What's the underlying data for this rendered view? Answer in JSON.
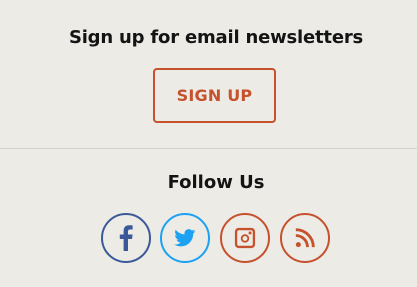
{
  "newsletter": {
    "title": "Sign up for email newsletters",
    "button_label": "SIGN UP"
  },
  "follow": {
    "title": "Follow Us",
    "icons": [
      "facebook-icon",
      "twitter-icon",
      "instagram-icon",
      "rss-icon"
    ]
  },
  "colors": {
    "background": "#ecebe6",
    "accent": "#c5512d",
    "facebook": "#3b5998",
    "twitter": "#1da1f2",
    "text": "#141414"
  }
}
